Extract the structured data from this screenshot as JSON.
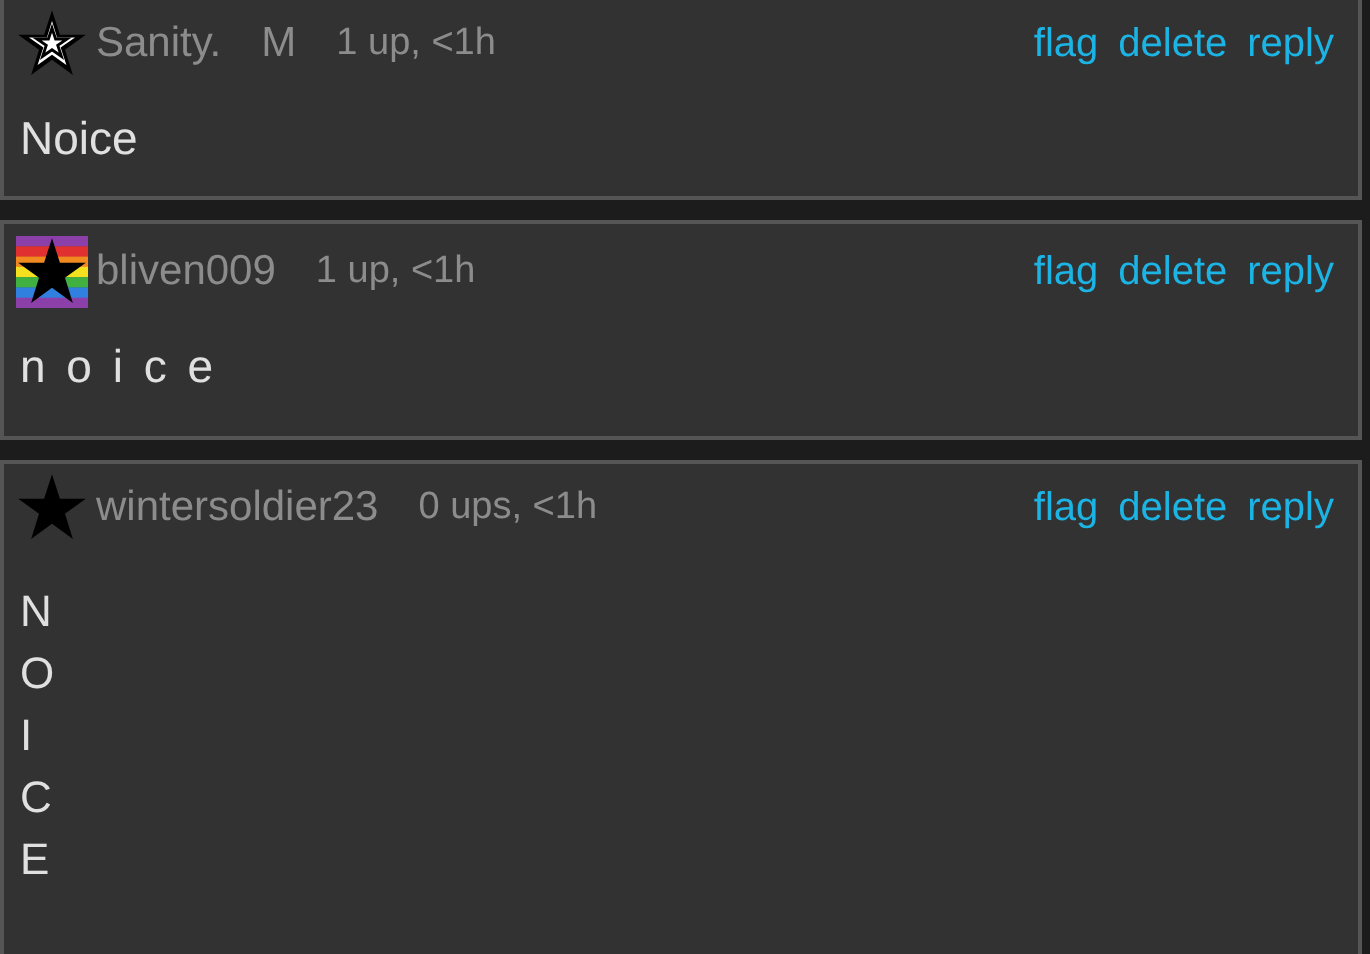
{
  "comments": [
    {
      "badge": {
        "kind": "outline-star"
      },
      "username": "Sanity.",
      "tag": "M",
      "meta": "1 up, <1h",
      "actions": [
        "flag",
        "delete",
        "reply"
      ],
      "body": {
        "kind": "plain",
        "text": "Noice"
      }
    },
    {
      "badge": {
        "kind": "rainbow-star"
      },
      "username": "bliven009",
      "meta": "1 up, <1h",
      "actions": [
        "flag",
        "delete",
        "reply"
      ],
      "body": {
        "kind": "spaced",
        "text": "n o i c e"
      }
    },
    {
      "badge": {
        "kind": "black-star"
      },
      "username": "wintersoldier23",
      "meta": "0 ups, <1h",
      "actions": [
        "flag",
        "delete",
        "reply"
      ],
      "body": {
        "kind": "stacked",
        "lines": [
          "N",
          "O",
          "I",
          "C",
          "E"
        ]
      }
    }
  ]
}
